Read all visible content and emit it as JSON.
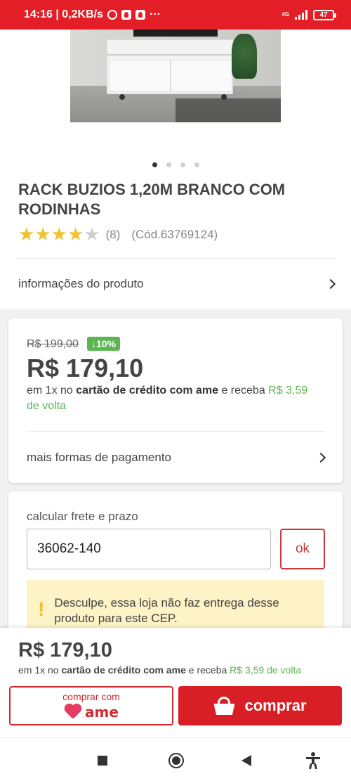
{
  "status_bar": {
    "time_info": "14:16 | 0,2KB/s",
    "more": "···",
    "network": "4G",
    "battery": "47"
  },
  "product": {
    "title": "RACK BUZIOS 1,20M BRANCO COM RODINHAS",
    "rating": 4,
    "rating_max": 5,
    "review_count": "(8)",
    "code": "(Cód.63769124)",
    "image_count": 4,
    "active_image": 1,
    "info_link": "informações do produto"
  },
  "price_card": {
    "old_price": "R$ 199,00",
    "discount": "↓10%",
    "price": "R$ 179,10",
    "installments_prefix": "em 1x no ",
    "installments_card": "cartão de crédito com ame",
    "installments_mid": " e receba ",
    "cashback": "R$ 3,59 de volta",
    "more_payments": "mais formas de pagamento"
  },
  "frete": {
    "label": "calcular frete e prazo",
    "cep_value": "36062-140",
    "ok_label": "ok",
    "warning_icon": "!",
    "warning": "Desculpe, essa loja não faz entrega desse produto para este CEP."
  },
  "bottom_bar": {
    "price": "R$ 179,10",
    "desc_prefix": "em 1x no ",
    "desc_card": "cartão de crédito com ame",
    "desc_mid": " e receba ",
    "cashback": "R$ 3,59 de volta",
    "ame_button_top": "comprar com",
    "ame_logo_text": "ame",
    "buy_label": "comprar"
  },
  "colors": {
    "brand_red": "#e41e26",
    "cashback_green": "#5ab552",
    "star_yellow": "#f2c12e",
    "warning_bg": "#fdf3c6"
  },
  "icons": {
    "alarm": "alarm-icon",
    "signal": "signal-icon",
    "battery": "battery-icon",
    "chevron": "chevron-right-icon",
    "warning": "warning-icon",
    "basket": "basket-icon",
    "ame_heart": "ame-heart-icon",
    "nav_recent": "recent-apps-icon",
    "nav_home": "home-icon",
    "nav_back": "back-icon",
    "nav_accessibility": "accessibility-icon"
  }
}
